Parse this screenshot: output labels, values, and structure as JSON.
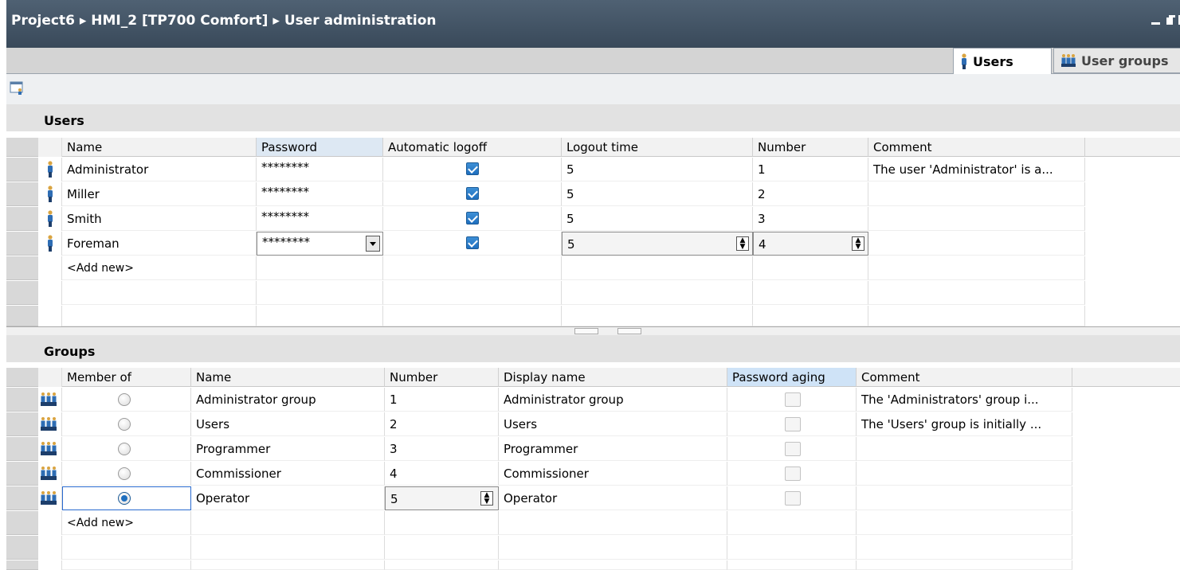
{
  "window": {
    "breadcrumb": "Project6  ▸  HMI_2 [TP700 Comfort]  ▸  User administration"
  },
  "tabs": [
    {
      "label": "Users",
      "icon": "user-icon",
      "active": true
    },
    {
      "label": "User groups",
      "icon": "group-icon",
      "active": false
    }
  ],
  "users": {
    "title": "Users",
    "columns": {
      "name": "Name",
      "password": "Password",
      "auto_logoff": "Automatic logoff",
      "logout_time": "Logout time",
      "number": "Number",
      "comment": "Comment"
    },
    "rows": [
      {
        "name": "Administrator",
        "password": "********",
        "auto_logoff": true,
        "logout_time": "5",
        "number": "1",
        "comment": "The user 'Administrator' is a..."
      },
      {
        "name": "Miller",
        "password": "********",
        "auto_logoff": true,
        "logout_time": "5",
        "number": "2",
        "comment": ""
      },
      {
        "name": "Smith",
        "password": "********",
        "auto_logoff": true,
        "logout_time": "5",
        "number": "3",
        "comment": ""
      },
      {
        "name": "Foreman",
        "password": "********",
        "auto_logoff": true,
        "logout_time": "5",
        "number": "4",
        "comment": ""
      }
    ],
    "add_new": "<Add new>"
  },
  "groups": {
    "title": "Groups",
    "columns": {
      "member_of": "Member of",
      "name": "Name",
      "number": "Number",
      "display_name": "Display name",
      "password_aging": "Password aging",
      "comment": "Comment"
    },
    "rows": [
      {
        "member": false,
        "name": "Administrator group",
        "number": "1",
        "display_name": "Administrator group",
        "password_aging": false,
        "comment": "The 'Administrators' group i..."
      },
      {
        "member": false,
        "name": "Users",
        "number": "2",
        "display_name": "Users",
        "password_aging": false,
        "comment": "The 'Users' group is initially ..."
      },
      {
        "member": false,
        "name": "Programmer",
        "number": "3",
        "display_name": "Programmer",
        "password_aging": false,
        "comment": ""
      },
      {
        "member": false,
        "name": "Commissioner",
        "number": "4",
        "display_name": "Commissioner",
        "password_aging": false,
        "comment": ""
      },
      {
        "member": true,
        "name": "Operator",
        "number": "5",
        "display_name": "Operator",
        "password_aging": false,
        "comment": ""
      }
    ],
    "add_new": "<Add new>"
  },
  "colors": {
    "titlebar": "#4f6173",
    "accent_blue": "#1f6fbf",
    "header_highlight": "#cfe3f7"
  }
}
